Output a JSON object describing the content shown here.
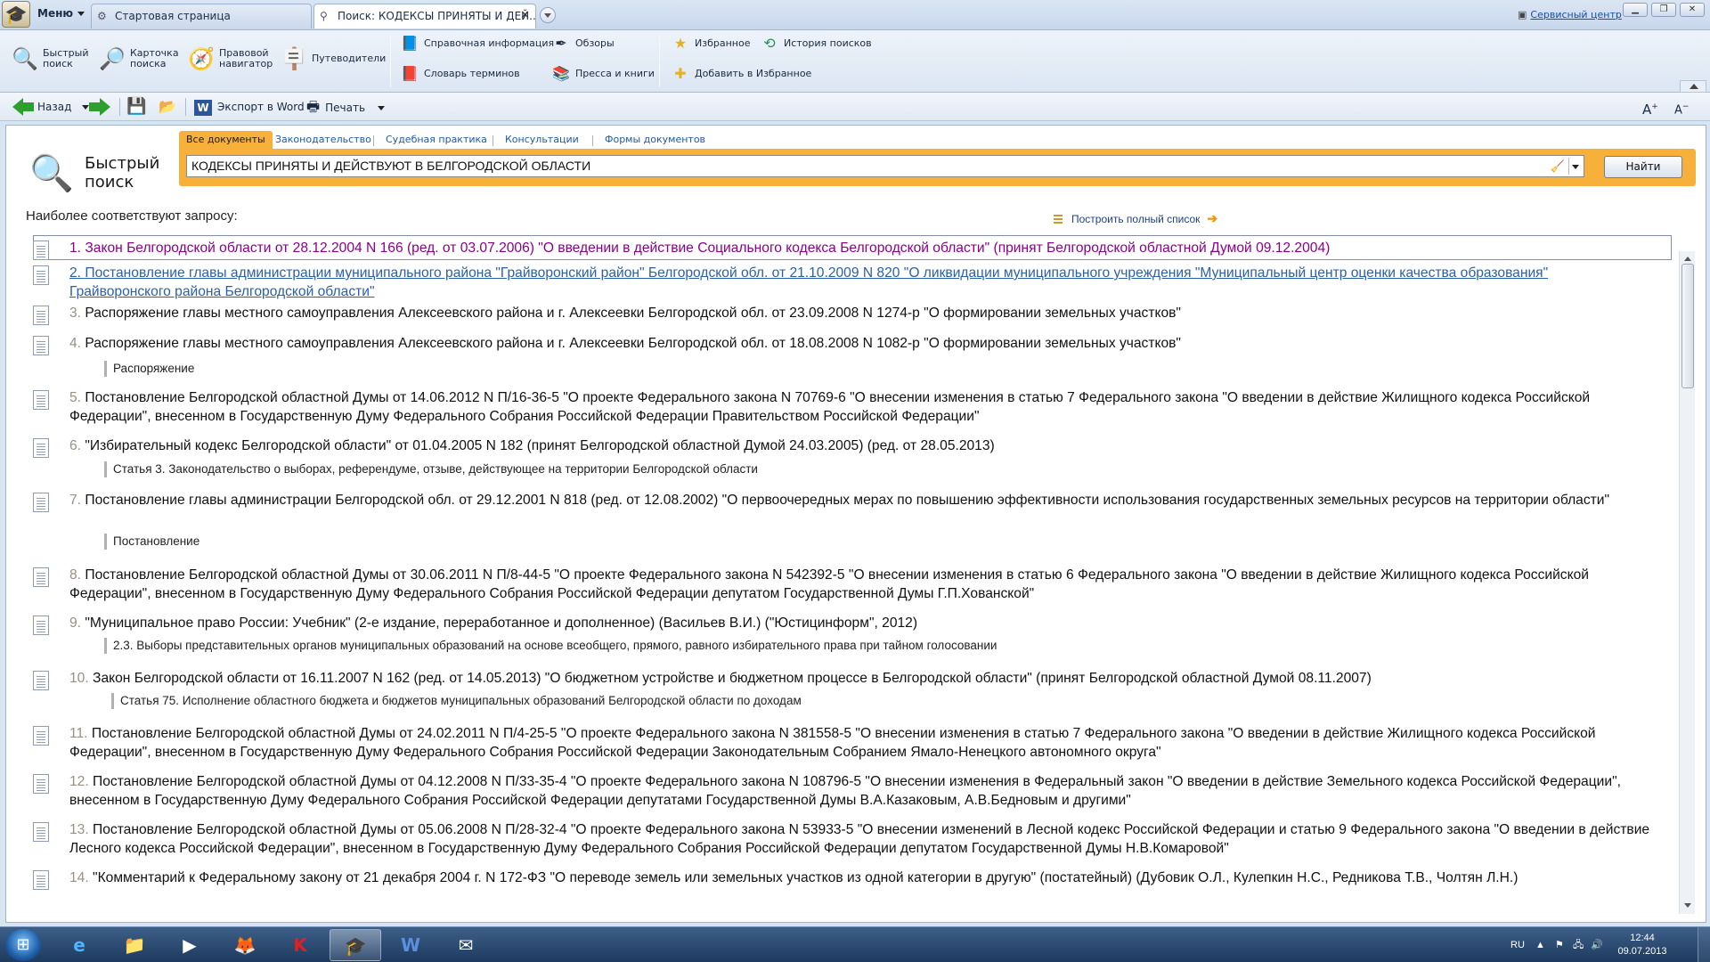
{
  "titlebar": {
    "menu_label": "Меню",
    "tabs": [
      {
        "label": "Стартовая страница"
      },
      {
        "label": "Поиск: КОДЕКСЫ ПРИНЯТЫ И ДЕЙ..."
      }
    ],
    "service_link": "Сервисный центр"
  },
  "ribbon": {
    "quick_search": "Быстрый\nпоиск",
    "search_card": "Карточка\nпоиска",
    "legal_navigator": "Правовой\nнавигатор",
    "guides": "Путеводители",
    "reference_info": "Справочная информация",
    "reviews": "Обзоры",
    "glossary": "Словарь терминов",
    "press_books": "Пресса и книги",
    "favorites": "Избранное",
    "search_history": "История поисков",
    "add_favorites": "Добавить в Избранное"
  },
  "toolbar": {
    "back_label": "Назад",
    "export_word": "Экспорт в Word",
    "print_label": "Печать"
  },
  "search": {
    "title": "Быстрый\nпоиск",
    "tabs": [
      "Все документы",
      "Законодательство",
      "Судебная практика",
      "Консультации",
      "Формы документов"
    ],
    "query": "КОДЕКСЫ ПРИНЯТЫ И ДЕЙСТВУЮТ В БЕЛГОРОДСКОЙ ОБЛАСТИ",
    "find_button": "Найти"
  },
  "results_header": {
    "best_match": "Наиболее соответствуют запросу:",
    "full_list": "Построить полный список"
  },
  "results": [
    {
      "num": "1.",
      "text": "Закон Белгородской области от 28.12.2004 N 166 (ред. от 03.07.2006) \"О введении в действие Социального кодекса Белгородской области\" (принят Белгородской областной Думой 09.12.2004)",
      "fragment": ""
    },
    {
      "num": "2.",
      "text": "Постановление главы администрации муниципального района \"Грайворонский район\" Белгородской обл. от 21.10.2009 N 820 \"О ликвидации муниципального учреждения \"Муниципальный центр оценки качества образования\" Грайворонского района Белгородской области\"",
      "fragment": ""
    },
    {
      "num": "3.",
      "text": "Распоряжение главы местного самоуправления Алексеевского района и г. Алексеевки Белгородской обл. от 23.09.2008 N 1274-р \"О формировании земельных участков\"",
      "fragment": ""
    },
    {
      "num": "4.",
      "text": "Распоряжение главы местного самоуправления Алексеевского района и г. Алексеевки Белгородской обл. от 18.08.2008 N 1082-р \"О формировании земельных участков\"",
      "fragment": "Распоряжение"
    },
    {
      "num": "5.",
      "text": "Постановление Белгородской областной Думы от 14.06.2012 N П/16-36-5 \"О проекте Федерального закона N 70769-6 \"О внесении изменения в статью 7 Федерального закона \"О введении в действие Жилищного кодекса Российской Федерации\", внесенном в Государственную Думу Федерального Собрания Российской Федерации Правительством Российской Федерации\"",
      "fragment": ""
    },
    {
      "num": "6.",
      "text": "\"Избирательный кодекс Белгородской области\" от 01.04.2005 N 182 (принят Белгородской областной Думой 24.03.2005) (ред. от 28.05.2013)",
      "fragment": "Статья 3. Законодательство о выборах, референдуме, отзыве, действующее на территории Белгородской области"
    },
    {
      "num": "7.",
      "text": "Постановление главы администрации Белгородской обл. от 29.12.2001 N 818 (ред. от 12.08.2002) \"О первоочередных мерах по повышению эффективности использования государственных земельных ресурсов на территории области\"",
      "fragment": "Постановление"
    },
    {
      "num": "8.",
      "text": "Постановление Белгородской областной Думы от 30.06.2011 N П/8-44-5 \"О проекте Федерального закона N 542392-5 \"О внесении изменения в статью 6 Федерального закона \"О введении в действие Жилищного кодекса Российской Федерации\", внесенном в Государственную Думу Федерального Собрания Российской Федерации депутатом Государственной Думы Г.П.Хованской\"",
      "fragment": ""
    },
    {
      "num": "9.",
      "text": "\"Муниципальное право России: Учебник\" (2-е издание, переработанное и дополненное) (Васильев В.И.) (\"Юстицинформ\", 2012)",
      "fragment": "2.3. Выборы представительных органов муниципальных образований на основе всеобщего, прямого, равного избирательного права при тайном голосовании"
    },
    {
      "num": "10.",
      "text": "Закон Белгородской области от 16.11.2007 N 162 (ред. от 14.05.2013) \"О бюджетном устройстве и бюджетном процессе в Белгородской области\" (принят Белгородской областной Думой 08.11.2007)",
      "fragment": "Статья 75. Исполнение областного бюджета и бюджетов муниципальных образований Белгородской области по доходам"
    },
    {
      "num": "11.",
      "text": "Постановление Белгородской областной Думы от 24.02.2011 N П/4-25-5 \"О проекте Федерального закона N 381558-5 \"О внесении изменения в статью 7 Федерального закона \"О введении в действие Жилищного кодекса Российской Федерации\", внесенном в Государственную Думу Федерального Собрания Российской Федерации Законодательным Собранием Ямало-Ненецкого автономного округа\"",
      "fragment": ""
    },
    {
      "num": "12.",
      "text": "Постановление Белгородской областной Думы от 04.12.2008 N П/33-35-4 \"О проекте Федерального закона N 108796-5 \"О внесении изменения в Федеральный закон \"О введении в действие Земельного кодекса Российской Федерации\", внесенном в Государственную Думу Федерального Собрания Российской Федерации депутатами Государственной Думы В.А.Казаковым, А.В.Бедновым и другими\"",
      "fragment": ""
    },
    {
      "num": "13.",
      "text": "Постановление Белгородской областной Думы от 05.06.2008 N П/28-32-4 \"О проекте Федерального закона N 53933-5 \"О внесении изменений в Лесной кодекс Российской Федерации и статью 9 Федерального закона \"О введении в действие Лесного кодекса Российской Федерации\", внесенном в Государственную Думу Федерального Собрания Российской Федерации депутатом Государственной Думы Н.В.Комаровой\"",
      "fragment": ""
    },
    {
      "num": "14.",
      "text": "\"Комментарий к Федеральному закону от 21 декабря 2004 г. N 172-ФЗ \"О переводе земель или земельных участков из одной категории в другую\" (постатейный) (Дубовик О.Л., Кулепкин Н.С., Редникова Т.В., Чолтян Л.Н.)",
      "fragment": ""
    }
  ],
  "taskbar": {
    "lang": "RU",
    "time": "12:44",
    "date": "09.07.2013"
  },
  "colors": {
    "search_band": "#f7b13a",
    "visited_link": "#8b008b",
    "hover_link": "#2b5fa8",
    "result_number": "#9a8f82"
  }
}
